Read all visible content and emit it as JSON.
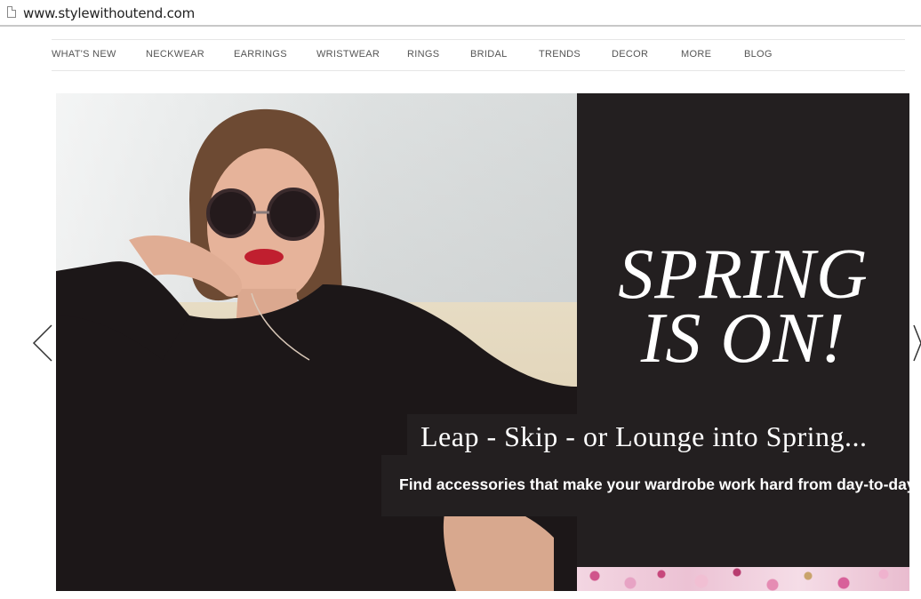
{
  "browser": {
    "url": "www.stylewithoutend.com"
  },
  "nav": {
    "items": [
      {
        "label": "WHAT'S NEW"
      },
      {
        "label": "NECKWEAR"
      },
      {
        "label": "EARRINGS"
      },
      {
        "label": "WRISTWEAR"
      },
      {
        "label": "RINGS"
      },
      {
        "label": "BRIDAL"
      },
      {
        "label": "TRENDS"
      },
      {
        "label": "DECOR"
      },
      {
        "label": "MORE"
      },
      {
        "label": "BLOG"
      }
    ]
  },
  "hero": {
    "headline_line1": "SPRING",
    "headline_line2": "IS ON!",
    "tagline": "Leap - Skip - or Lounge into Spring...",
    "subtext": "Find accessories that make your wardrobe work hard from day-to-day.",
    "prev_icon": "chevron-left-icon",
    "next_icon": "chevron-right-icon",
    "panel_color": "#231f20"
  }
}
